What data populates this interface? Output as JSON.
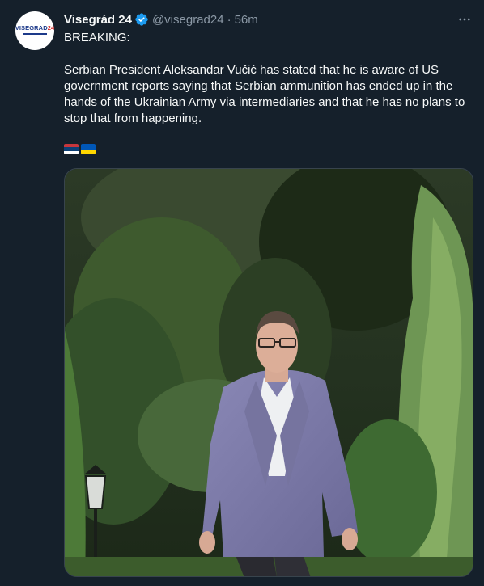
{
  "author": {
    "display_name": "Visegrád 24",
    "handle": "@visegrad24",
    "separator": "·",
    "time": "56m",
    "avatar_logo": {
      "prefix": "VISEGRAD",
      "suffix": "24"
    },
    "verified_icon": "verified-badge-icon"
  },
  "tweet": {
    "line1": "BREAKING:",
    "paragraph": "Serbian President Aleksandar Vučić has stated that he is aware of US government reports saying that Serbian ammunition has ended up in the hands of the Ukrainian Army via intermediaries and that he has no plans to stop that from happening.",
    "flags": [
      "serbia-flag-emoji",
      "ukraine-flag-emoji"
    ]
  },
  "media": {
    "type": "photo"
  },
  "colors": {
    "background": "#15202b",
    "text": "#f7f9f9",
    "muted": "#8b98a5",
    "verified": "#1d9bf0"
  },
  "icons": {
    "more": "more-options-icon"
  }
}
